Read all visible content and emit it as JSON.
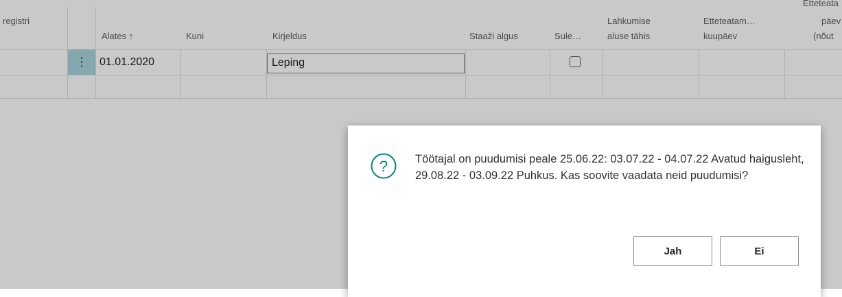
{
  "table": {
    "headers": {
      "registri": "registri",
      "alates": "Alates ↑",
      "kuni": "Kuni",
      "kirjeldus": "Kirjeldus",
      "staazi": "Staaži algus",
      "sule": "Sule…",
      "lahkumise_line1": "Lahkumise",
      "lahkumise_line2": "aluse tähis",
      "etteteatam_line1": "Etteteatam…",
      "etteteatam_line2": "kuupäev",
      "last_line0": "Etteteata",
      "last_line1": "päev",
      "last_line2": "(nõut"
    },
    "row1": {
      "menu_icon": "⋮",
      "alates": "01.01.2020",
      "kirjeldus": "Leping",
      "sule_checked": false
    }
  },
  "dialog": {
    "icon": "question-icon",
    "icon_symbol": "?",
    "message": "Töötajal on puudumisi peale 25.06.22: 03.07.22 - 04.07.22 Avatud haigusleht, 29.08.22 - 03.09.22 Puhkus. Kas soovite vaadata neid puudumisi?",
    "yes_label": "Jah",
    "no_label": "Ei"
  },
  "colors": {
    "accent": "#008489",
    "row_handle": "#a8d5dc"
  }
}
